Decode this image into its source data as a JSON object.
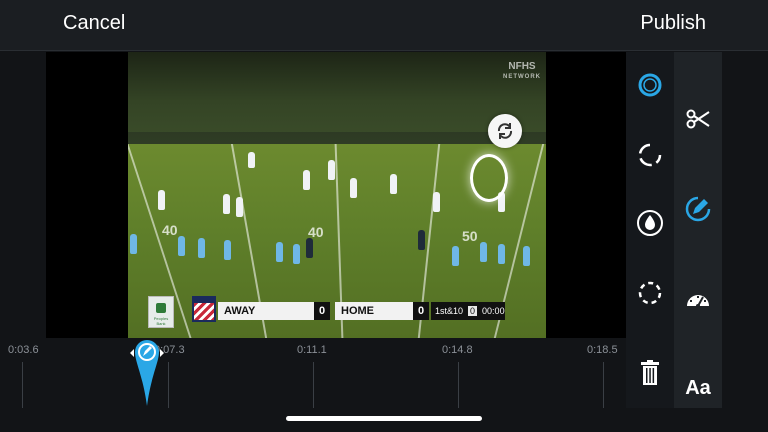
{
  "header": {
    "cancel_label": "Cancel",
    "publish_label": "Publish"
  },
  "video": {
    "watermark_line1": "NFHS",
    "watermark_line2": "NETWORK",
    "yard_numbers": [
      "40",
      "40",
      "50"
    ],
    "scorebug": {
      "sponsor_text": "Peoples Bank",
      "away_label": "AWAY",
      "away_score": "0",
      "home_label": "HOME",
      "home_score": "0",
      "down_distance": "1st&10",
      "quarter": "0",
      "clock": "00:00"
    }
  },
  "timeline": {
    "labels": [
      "0:03.6",
      "0:07.3",
      "0:11.1",
      "0:14.8",
      "0:18.5"
    ]
  },
  "tools": {
    "column1": [
      "spotlight-tool",
      "rotate-tool",
      "drop-tool",
      "dashed-circle-tool",
      "trash"
    ],
    "column2": [
      "scissors",
      "pen",
      "speed",
      "text"
    ],
    "text_tool_label": "Aa",
    "accent": "#2aa7e6"
  }
}
